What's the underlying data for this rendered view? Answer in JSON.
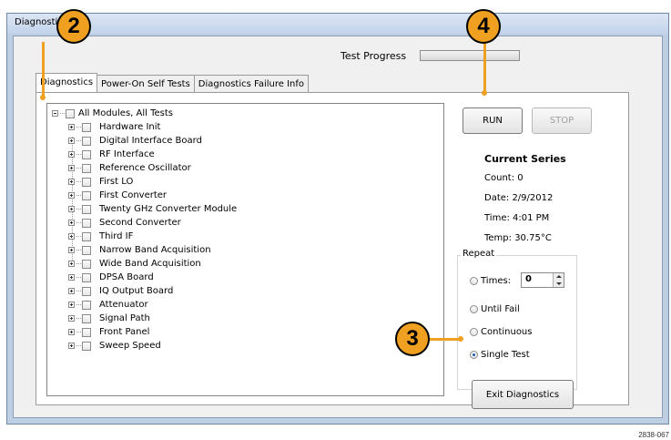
{
  "window": {
    "title": "Diagnostics"
  },
  "progress": {
    "label": "Test Progress",
    "percent": 0
  },
  "tabs": [
    {
      "label": "Diagnostics"
    },
    {
      "label": "Power-On Self Tests"
    },
    {
      "label": "Diagnostics Failure Info"
    }
  ],
  "tree": {
    "root": "All Modules, All Tests",
    "items": [
      "Hardware Init",
      "Digital Interface Board",
      "RF Interface",
      "Reference Oscillator",
      "First LO",
      "First Converter",
      "Twenty GHz Converter Module",
      "Second Converter",
      "Third IF",
      "Narrow Band Acquisition",
      "Wide Band Acquisition",
      "DPSA Board",
      "IQ Output Board",
      "Attenuator",
      "Signal Path",
      "Front Panel",
      "Sweep Speed"
    ]
  },
  "buttons": {
    "run": "RUN",
    "stop": "STOP",
    "exit": "Exit Diagnostics"
  },
  "series": {
    "heading": "Current Series",
    "count": "Count: 0",
    "date": "Date:  2/9/2012",
    "time": "Time:  4:01 PM",
    "temp": "Temp:  30.75°C"
  },
  "repeat": {
    "legend": "Repeat",
    "times_label": "Times:",
    "times_value": "0",
    "until_fail": "Until Fail",
    "continuous": "Continuous",
    "single_test": "Single Test",
    "selected": "single_test"
  },
  "callouts": [
    "2",
    "3",
    "4"
  ],
  "colors": {
    "callout": "#f0a020",
    "titlebar": "#c2d3ea"
  },
  "figure_number": "2838-067"
}
